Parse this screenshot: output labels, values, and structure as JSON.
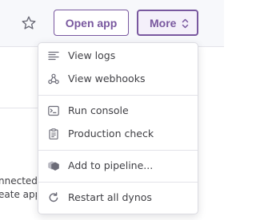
{
  "header": {
    "open_app_label": "Open app",
    "more_label": "More"
  },
  "background": {
    "line1": "nnected",
    "line2": "eate app"
  },
  "menu": {
    "items": [
      {
        "label": "View logs",
        "icon": "logs-icon"
      },
      {
        "label": "View webhooks",
        "icon": "webhooks-icon"
      },
      {
        "label": "Run console",
        "icon": "console-icon"
      },
      {
        "label": "Production check",
        "icon": "clipboard-check-icon"
      },
      {
        "label": "Add to pipeline...",
        "icon": "pipeline-icon"
      },
      {
        "label": "Restart all dynos",
        "icon": "restart-icon"
      }
    ]
  },
  "colors": {
    "accent": "#79589f",
    "text": "#3f3f44",
    "icon": "#6c6c78",
    "topbar_bg": "#f7f8fb",
    "divider": "#e3e3e9"
  }
}
